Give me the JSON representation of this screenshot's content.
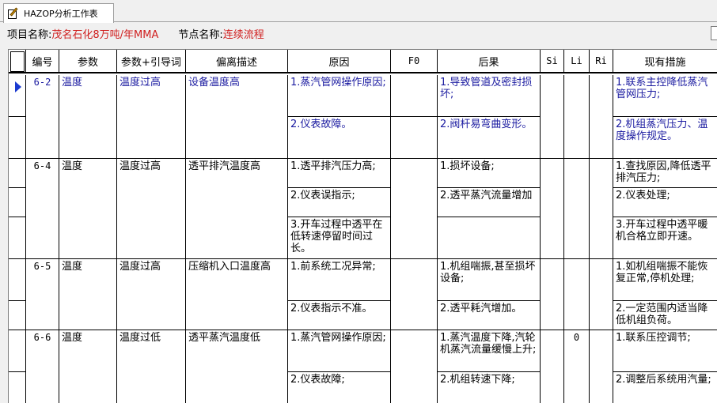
{
  "tab": {
    "label": "HAZOP分析工作表"
  },
  "info": {
    "project_label": "项目名称:",
    "project_value": "茂名石化8万吨/年MMA",
    "node_label": "节点名称:",
    "node_value": "连续流程"
  },
  "columns": {
    "id": "编号",
    "param": "参数",
    "guideword": "参数+引导词",
    "deviation": "偏离描述",
    "cause": "原因",
    "f0": "F0",
    "consequence": "后果",
    "si": "Si",
    "li": "Li",
    "ri": "Ri",
    "measures": "现有措施"
  },
  "groups": [
    {
      "id": "6-2",
      "param": "温度",
      "guideword": "温度过高",
      "deviation": "设备温度高"
    },
    {
      "id": "6-4",
      "param": "温度",
      "guideword": "温度过高",
      "deviation": "透平排汽温度高"
    },
    {
      "id": "6-5",
      "param": "温度",
      "guideword": "温度过高",
      "deviation": "压缩机入口温度高"
    },
    {
      "id": "6-6",
      "param": "温度",
      "guideword": "温度过低",
      "deviation": "透平蒸汽温度低"
    }
  ],
  "rows": [
    {
      "cause": "1.蒸汽管网操作原因;",
      "consequence": "1.导致管道及密封损坏;",
      "li": "",
      "measure": "1.联系主控降低蒸汽管网压力;"
    },
    {
      "cause": "2.仪表故障。",
      "consequence": "2.阀杆易弯曲变形。",
      "li": "",
      "measure": "2.机组蒸汽压力、温度操作规定。"
    },
    {
      "cause": "1.透平排汽压力高;",
      "consequence": "1.损坏设备;",
      "li": "",
      "measure": "1.查找原因,降低透平排汽压力;"
    },
    {
      "cause": "2.仪表误指示;",
      "consequence": "2.透平蒸汽流量增加",
      "li": "",
      "measure": "2.仪表处理;"
    },
    {
      "cause": "3.开车过程中透平在低转速停留时间过长。",
      "consequence": "",
      "li": "",
      "measure": "3.开车过程中透平暖机合格立即开速。"
    },
    {
      "cause": "1.前系统工况异常;",
      "consequence": "1.机组喘振,甚至损坏设备;",
      "li": "",
      "measure": "1.如机组喘振不能恢复正常,停机处理;"
    },
    {
      "cause": "2.仪表指示不准。",
      "consequence": "2.透平耗汽增加。",
      "li": "",
      "measure": "2.一定范围内适当降低机组负荷。"
    },
    {
      "cause": "1.蒸汽管网操作原因;",
      "consequence": "1.蒸汽温度下降,汽轮机蒸汽流量缓慢上升;",
      "li": "0",
      "measure": "1.联系压控调节;"
    },
    {
      "cause": "2.仪表故障;",
      "consequence": "2.机组转速下降;",
      "li": "",
      "measure": "2.调整后系统用汽量;"
    }
  ],
  "colors": {
    "highlight_text": "#1a1aa0",
    "value_red": "#d02020",
    "row_indicator": "#1a3ad0"
  }
}
